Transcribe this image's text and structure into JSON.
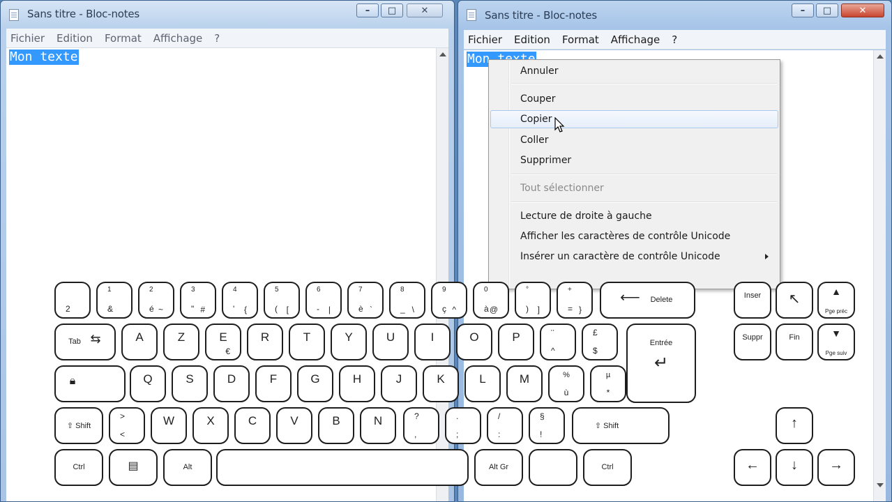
{
  "left_window": {
    "title": "Sans titre - Bloc-notes",
    "controls": {
      "minimize": "–",
      "maximize": "□",
      "close": "✕"
    },
    "menu": [
      "Fichier",
      "Edition",
      "Format",
      "Affichage",
      "?"
    ],
    "text": "Mon texte"
  },
  "right_window": {
    "title": "Sans titre - Bloc-notes",
    "controls": {
      "minimize": "–",
      "maximize": "□",
      "close": "✕"
    },
    "menu": [
      "Fichier",
      "Edition",
      "Format",
      "Affichage",
      "?"
    ],
    "text": "Mon texte"
  },
  "context_menu": {
    "items": [
      {
        "label": "Annuler",
        "state": "normal"
      },
      {
        "label": "Couper",
        "state": "normal"
      },
      {
        "label": "Copier",
        "state": "hover"
      },
      {
        "label": "Coller",
        "state": "normal"
      },
      {
        "label": "Supprimer",
        "state": "normal"
      },
      {
        "label": "Tout sélectionner",
        "state": "disabled"
      },
      {
        "label": "Lecture de droite à gauche",
        "state": "normal"
      },
      {
        "label": "Afficher les caractères de contrôle Unicode",
        "state": "normal"
      },
      {
        "label": "Insérer un caractère de contrôle Unicode",
        "state": "submenu"
      }
    ]
  },
  "keyboard": {
    "row1": [
      {
        "top": "",
        "bot": "2"
      },
      {
        "top": "1",
        "bot": "&"
      },
      {
        "top": "2",
        "bot": "é",
        "alt": "~"
      },
      {
        "top": "3",
        "bot": "\"",
        "alt": "#"
      },
      {
        "top": "4",
        "bot": "'",
        "alt": "{"
      },
      {
        "top": "5",
        "bot": "(",
        "alt": "["
      },
      {
        "top": "6",
        "bot": "-",
        "alt": "|"
      },
      {
        "top": "7",
        "bot": "è",
        "alt": "`"
      },
      {
        "top": "8",
        "bot": "_",
        "alt": "\\"
      },
      {
        "top": "9",
        "bot": "ç",
        "alt": "^"
      },
      {
        "top": "0",
        "bot": "à",
        "alt": "@"
      },
      {
        "top": "°",
        "bot": ")",
        "alt": "]"
      },
      {
        "top": "+",
        "bot": "=",
        "alt": "}"
      }
    ],
    "delete_label": "Delete",
    "row2_letters": [
      "A",
      "Z",
      "E",
      "R",
      "T",
      "Y",
      "U",
      "I",
      "O",
      "P"
    ],
    "row2_alt": {
      "E": "€"
    },
    "row2_extra": [
      {
        "top": "¨",
        "bot": "^"
      },
      {
        "top": "£",
        "bot": "$"
      }
    ],
    "tab_label": "Tab",
    "enter_label": "Entrée",
    "row3_letters": [
      "Q",
      "S",
      "D",
      "F",
      "G",
      "H",
      "J",
      "K",
      "L",
      "M"
    ],
    "row3_extra": [
      {
        "top": "%",
        "bot": "ù"
      },
      {
        "top": "µ",
        "bot": "*"
      }
    ],
    "row4_letters": [
      "W",
      "X",
      "C",
      "V",
      "B",
      "N"
    ],
    "row4_left": {
      "top": ">",
      "bot": "<"
    },
    "row4_punct": [
      {
        "top": "?",
        "bot": ","
      },
      {
        "top": ".",
        "bot": ";"
      },
      {
        "top": "/",
        "bot": ":"
      },
      {
        "top": "§",
        "bot": "!"
      }
    ],
    "shift_label": "Shift",
    "ctrl_label": "Ctrl",
    "alt_label": "Alt",
    "altgr_label": "Alt Gr",
    "nav": {
      "insert": "Inser",
      "home_arrow": "↖",
      "pgup": "Pge préc",
      "delete": "Suppr",
      "end": "Fin",
      "pgdn": "Pge suiv"
    },
    "arrows": {
      "up": "↑",
      "left": "←",
      "down": "↓",
      "right": "→"
    }
  }
}
